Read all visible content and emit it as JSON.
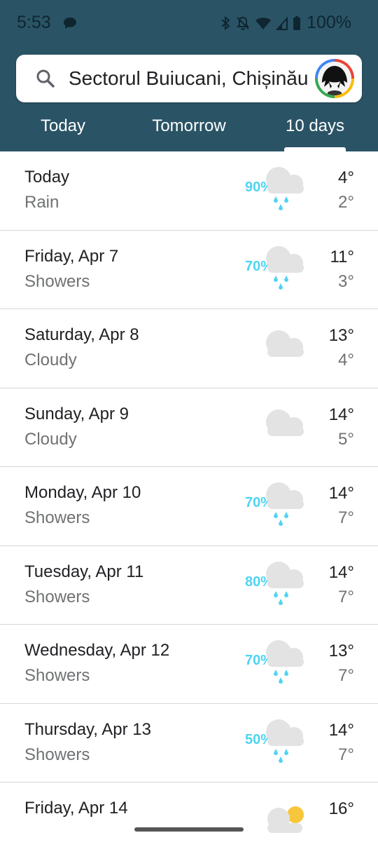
{
  "status": {
    "time": "5:53",
    "battery": "100%"
  },
  "search": {
    "location": "Sectorul Buiucani, Chișinău"
  },
  "tabs": [
    "Today",
    "Tomorrow",
    "10 days"
  ],
  "forecast": [
    {
      "day": "Today",
      "condition": "Rain",
      "precip": "90%",
      "icon": "rain-icon",
      "high": "4°",
      "low": "2°"
    },
    {
      "day": "Friday, Apr 7",
      "condition": "Showers",
      "precip": "70%",
      "icon": "showers-icon",
      "high": "11°",
      "low": "3°"
    },
    {
      "day": "Saturday, Apr 8",
      "condition": "Cloudy",
      "precip": "",
      "icon": "cloudy-icon",
      "high": "13°",
      "low": "4°"
    },
    {
      "day": "Sunday, Apr 9",
      "condition": "Cloudy",
      "precip": "",
      "icon": "cloudy-icon",
      "high": "14°",
      "low": "5°"
    },
    {
      "day": "Monday, Apr 10",
      "condition": "Showers",
      "precip": "70%",
      "icon": "showers-icon",
      "high": "14°",
      "low": "7°"
    },
    {
      "day": "Tuesday, Apr 11",
      "condition": "Showers",
      "precip": "80%",
      "icon": "showers-icon",
      "high": "14°",
      "low": "7°"
    },
    {
      "day": "Wednesday, Apr 12",
      "condition": "Showers",
      "precip": "70%",
      "icon": "showers-icon",
      "high": "13°",
      "low": "7°"
    },
    {
      "day": "Thursday, Apr 13",
      "condition": "Showers",
      "precip": "50%",
      "icon": "showers-icon",
      "high": "14°",
      "low": "7°"
    },
    {
      "day": "Friday, Apr 14",
      "condition": "",
      "precip": "",
      "icon": "partly-cloudy-icon",
      "high": "16°",
      "low": ""
    }
  ],
  "colors": {
    "header": "#2a5466",
    "precip": "#4fd4f2",
    "cloud": "#e3e3e3",
    "drop": "#4fd4f2",
    "sun": "#f7c63d"
  }
}
